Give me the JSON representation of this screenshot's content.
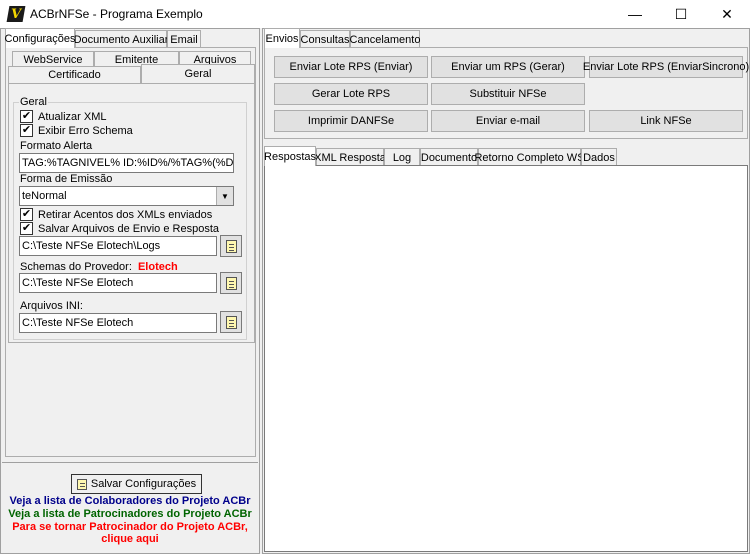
{
  "window": {
    "title": "ACBrNFSe - Programa Exemplo",
    "minimize": "—",
    "maximize": "☐",
    "close": "✕"
  },
  "left_tabs": [
    "Configurações",
    "Documento Auxiliar",
    "Email"
  ],
  "config_tabs_row1": [
    "WebService",
    "Emitente",
    "Arquivos"
  ],
  "config_tabs_row2": [
    "Certificado",
    "Geral"
  ],
  "geral": {
    "group_title": "Geral",
    "atualizar_xml": "Atualizar XML",
    "exibir_erro": "Exibir Erro Schema",
    "formato_alerta_label": "Formato Alerta",
    "formato_alerta_value": "TAG:%TAGNIVEL% ID:%ID%/%TAG%(%DESCRI",
    "forma_emissao_label": "Forma de Emissão",
    "forma_emissao_value": "teNormal",
    "retirar_acentos": "Retirar Acentos dos XMLs enviados",
    "salvar_arquivos": "Salvar Arquivos de Envio e Resposta",
    "logs_path": "C:\\Teste NFSe Elotech\\Logs",
    "schemas_label": "Schemas do Provedor:",
    "schemas_provider": "Elotech",
    "schemas_path": "C:\\Teste NFSe Elotech",
    "arquivos_ini_label": "Arquivos INI:",
    "arquivos_ini_path": "C:\\Teste NFSe Elotech",
    "check_mark": "✔"
  },
  "footer": {
    "save_button": "Salvar Configurações",
    "link_colaboradores": "Veja a lista de Colaboradores do Projeto ACBr",
    "link_patrocinadores": "Veja a lista de Patrocinadores do Projeto ACBr",
    "link_patrocinador_1": "Para se tornar Patrocinador do Projeto ACBr,",
    "link_patrocinador_2": "clique aqui",
    "color_blue": "#00008b",
    "color_green": "#006400",
    "color_red": "#ff0000"
  },
  "right_tabs": [
    "Envios",
    "Consultas",
    "Cancelamento"
  ],
  "envios_buttons": [
    "Enviar Lote RPS (Enviar)",
    "Enviar um RPS (Gerar)",
    "Enviar Lote RPS (EnviarSincrono)",
    "Gerar Lote RPS",
    "Substituir NFSe",
    "Imprimir DANFSe",
    "Enviar e-mail",
    "Link NFSe"
  ],
  "result_tabs": [
    "Respostas",
    "XML Resposta",
    "Log",
    "Documento",
    "Retorno Completo WS",
    "Dados"
  ],
  "icons": {
    "app": "acbr-logo-icon",
    "folder_button": "document-icon"
  }
}
